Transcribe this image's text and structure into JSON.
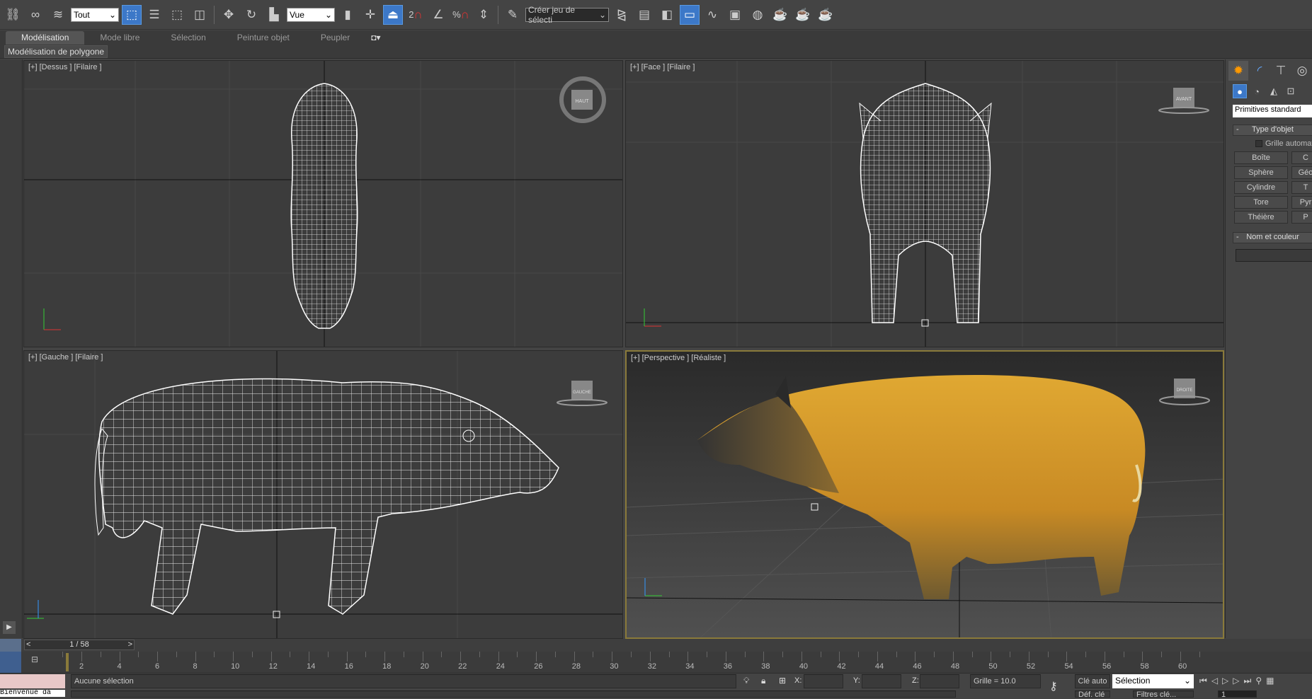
{
  "toolbar": {
    "selection_filter": "Tout",
    "coord_system": "Vue",
    "named_selection": "Créer jeu de sélecti",
    "snap_2": "2",
    "snap_percent": "%"
  },
  "ribbon": {
    "tabs": [
      "Modélisation",
      "Mode libre",
      "Sélection",
      "Peinture objet",
      "Peupler"
    ],
    "active_tab": "Modélisation",
    "sub_panel": "Modélisation de polygone"
  },
  "viewports": {
    "top": {
      "label": "[+] [Dessus ] [Filaire ]",
      "cube": "HAUT"
    },
    "front": {
      "label": "[+] [Face ] [Filaire ]",
      "cube": "AVANT"
    },
    "left": {
      "label": "[+] [Gauche ] [Filaire ]",
      "cube": "GAUCHE"
    },
    "persp": {
      "label": "[+] [Perspective ] [Réaliste ]",
      "cube": "DROITE"
    }
  },
  "command_panel": {
    "category": "Primitives standard",
    "rollout_type": "Type d'objet",
    "autogrid": "Grille automat",
    "buttons": [
      "Boîte",
      "Sphère",
      "Cylindre",
      "Tore",
      "Théière"
    ],
    "buttons_right": [
      "C",
      "Géo",
      "T",
      "Pyr",
      "P"
    ],
    "rollout_name": "Nom et couleur"
  },
  "timeline": {
    "frame_display": "1 / 58",
    "ticks": [
      "2",
      "4",
      "6",
      "8",
      "10",
      "12",
      "14",
      "16",
      "18",
      "20",
      "22",
      "24",
      "26",
      "28",
      "30",
      "32",
      "34",
      "36",
      "38",
      "40",
      "42",
      "44",
      "46",
      "48",
      "50",
      "52",
      "54",
      "56",
      "58",
      "60"
    ]
  },
  "status": {
    "selection": "Aucune sélection",
    "x_label": "X:",
    "y_label": "Y:",
    "z_label": "Z:",
    "grid": "Grille = 10.0",
    "auto_key": "Clé auto",
    "key_mode": "Sélection",
    "set_key": "Déf. clé",
    "key_filters": "Filtres clé...",
    "frame": "1",
    "welcome": "Bienvenue da"
  },
  "colors": {
    "accent": "#3c78c8",
    "active_viewport_border": "#8a7a3a"
  }
}
